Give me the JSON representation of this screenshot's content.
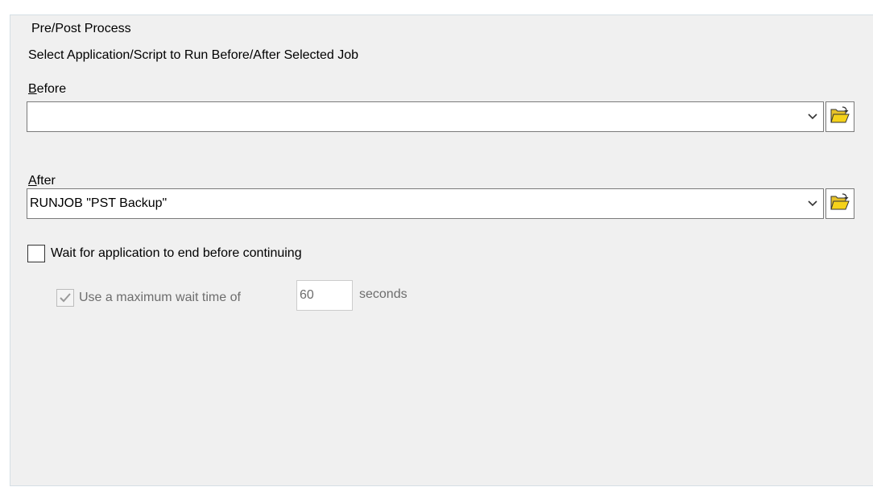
{
  "group": {
    "title": "Pre/Post Process"
  },
  "instruction": "Select Application/Script to Run Before/After Selected Job",
  "before": {
    "label_accel": "B",
    "label_rest": "efore",
    "value": ""
  },
  "after": {
    "label_accel": "A",
    "label_rest": "fter",
    "value": "RUNJOB \"PST Backup\""
  },
  "wait": {
    "label": "Wait for application to end before continuing",
    "checked": false
  },
  "max_wait": {
    "label": "Use a maximum wait time of",
    "checked": true,
    "enabled": false,
    "value": "60",
    "unit": "seconds"
  },
  "icons": {
    "dropdown": "chevron-down-icon",
    "browse": "open-folder-icon"
  },
  "colors": {
    "panel_bg": "#f0f0f0",
    "folder_yellow": "#f5d21a",
    "disabled_text": "#6d6d6d"
  }
}
